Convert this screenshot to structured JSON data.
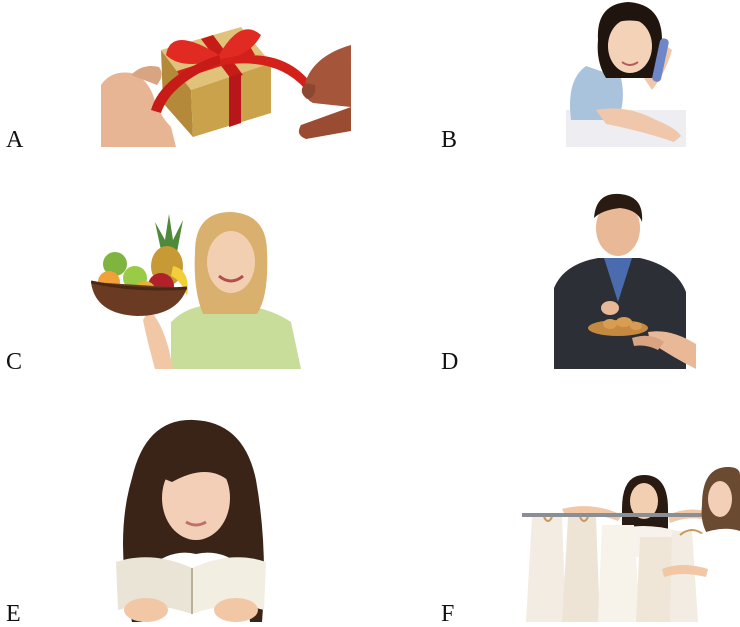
{
  "options": [
    {
      "letter": "A",
      "picture": "hands-opening-gift-box"
    },
    {
      "letter": "B",
      "picture": "woman-on-phone-lying-on-bed"
    },
    {
      "letter": "C",
      "picture": "woman-holding-fruit-bowl"
    },
    {
      "letter": "D",
      "picture": "man-taking-snack-from-plate"
    },
    {
      "letter": "E",
      "picture": "woman-reading-book"
    },
    {
      "letter": "F",
      "picture": "women-shopping-clothes-rack"
    }
  ],
  "colors": {
    "ribbon": "#d3201b",
    "gift_box": "#c9a24b",
    "skin": "#f1c7a6",
    "hair_dark": "#2a1b12",
    "hair_blonde": "#d9b06e",
    "shirt_green": "#c9dd9b",
    "suit": "#2c2f36",
    "clothes": "#f3ece2"
  }
}
